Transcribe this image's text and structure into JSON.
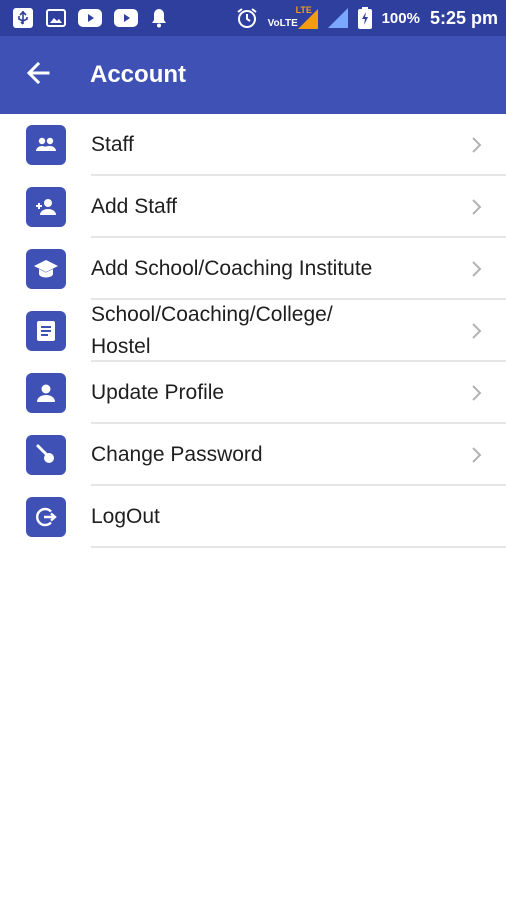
{
  "status_bar": {
    "battery_percent": "100%",
    "time": "5:25 pm",
    "volte": "VoLTE",
    "lte": "LTE",
    "icons": [
      "usb-icon",
      "image-icon",
      "youtube-icon",
      "youtube-icon",
      "bell-icon",
      "alarm-icon",
      "volte-icon",
      "signal-icon",
      "battery-charging-icon"
    ]
  },
  "app_bar": {
    "title": "Account",
    "back_icon": "arrow-back-icon"
  },
  "menu": {
    "items": [
      {
        "label": "Staff",
        "icon": "people-icon",
        "chevron": true
      },
      {
        "label": "Add Staff",
        "icon": "person-add-icon",
        "chevron": true
      },
      {
        "label": "Add School/Coaching Institute",
        "icon": "school-icon",
        "chevron": true
      },
      {
        "label": "School/Coaching/College/ Hostel",
        "icon": "document-icon",
        "chevron": true
      },
      {
        "label": "Update Profile",
        "icon": "person-icon",
        "chevron": true
      },
      {
        "label": "Change Password",
        "icon": "key-icon",
        "chevron": true
      },
      {
        "label": "LogOut",
        "icon": "logout-icon",
        "chevron": false
      }
    ]
  },
  "colors": {
    "primary": "#3f51b5",
    "status_bar": "#2f3f9e",
    "divider": "#e6e6e6",
    "chevron": "#b3b3b3"
  }
}
